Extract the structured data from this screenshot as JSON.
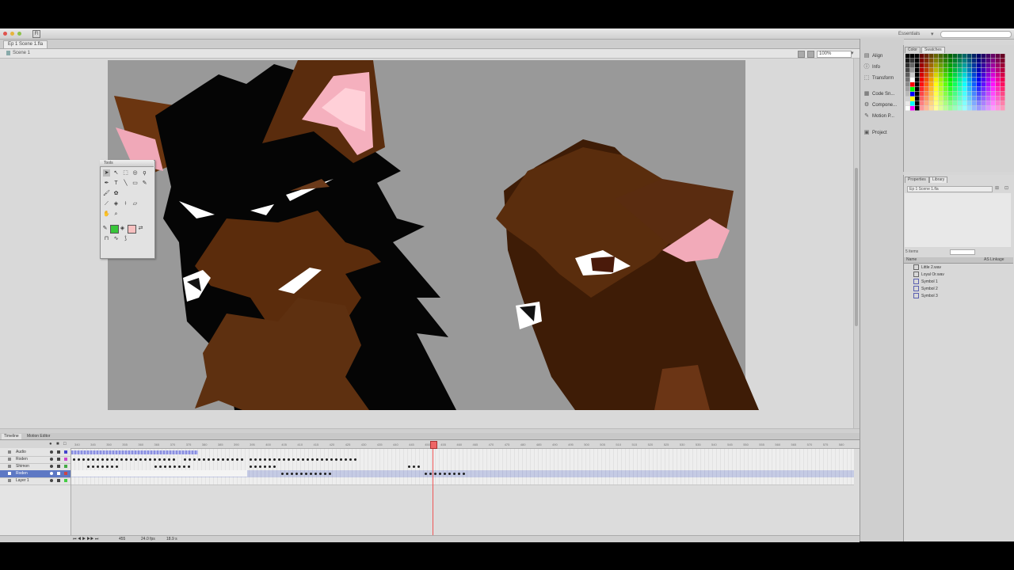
{
  "window": {
    "workspace": "Essentials"
  },
  "document": {
    "tab_label": "Ep 1 Scene 1.fla",
    "scene_label": "Scene 1",
    "zoom": "100%"
  },
  "tools_panel": {
    "tab_label": "Tools"
  },
  "right_strip": {
    "items": [
      {
        "label": "Align",
        "icon": "align-icon"
      },
      {
        "label": "Info",
        "icon": "info-icon"
      },
      {
        "label": "Transform",
        "icon": "transform-icon"
      },
      {
        "label": "Code Sn...",
        "icon": "code-snippets-icon"
      },
      {
        "label": "Compone...",
        "icon": "components-icon"
      },
      {
        "label": "Motion P...",
        "icon": "motion-presets-icon"
      },
      {
        "label": "Project",
        "icon": "project-icon"
      }
    ]
  },
  "color_panel": {
    "tabs": [
      "Color",
      "Swatches"
    ]
  },
  "library_panel": {
    "tabs": [
      "Properties",
      "Library"
    ],
    "doc_select": "Ep 1 Scene 1.fla",
    "item_count": "5 items",
    "header_name": "Name",
    "header_linkage": "AS Linkage",
    "items": [
      {
        "label": "Little 2.wav",
        "kind": "audio"
      },
      {
        "label": "Loyal Or.wav",
        "kind": "audio"
      },
      {
        "label": "Symbol 1",
        "kind": "symbol"
      },
      {
        "label": "Symbol 2",
        "kind": "symbol"
      },
      {
        "label": "Symbol 3",
        "kind": "symbol"
      }
    ]
  },
  "timeline": {
    "tabs": [
      "Timeline",
      "Motion Editor"
    ],
    "layers": [
      {
        "name": "Audio",
        "selected": false
      },
      {
        "name": "Roden",
        "selected": false
      },
      {
        "name": "Shimon",
        "selected": false
      },
      {
        "name": "Roden",
        "selected": true
      },
      {
        "name": "Layer 1",
        "selected": false
      }
    ],
    "ruler": [
      "340",
      "345",
      "350",
      "355",
      "360",
      "365",
      "370",
      "375",
      "380",
      "385",
      "390",
      "395",
      "400",
      "405",
      "410",
      "415",
      "420",
      "425",
      "430",
      "435",
      "440",
      "445",
      "450",
      "455",
      "460",
      "465",
      "470",
      "475",
      "480",
      "485",
      "490",
      "495",
      "500",
      "505",
      "510",
      "515",
      "520",
      "525",
      "530",
      "535",
      "540",
      "545",
      "550",
      "555",
      "560",
      "565",
      "570",
      "575",
      "580"
    ],
    "current_frame": "455",
    "fps": "24.0 fps",
    "time": "18.9 s"
  },
  "colors": {
    "accent_selection": "#5d78c4",
    "playhead": "#e55555",
    "stage_bg": "#999999"
  }
}
